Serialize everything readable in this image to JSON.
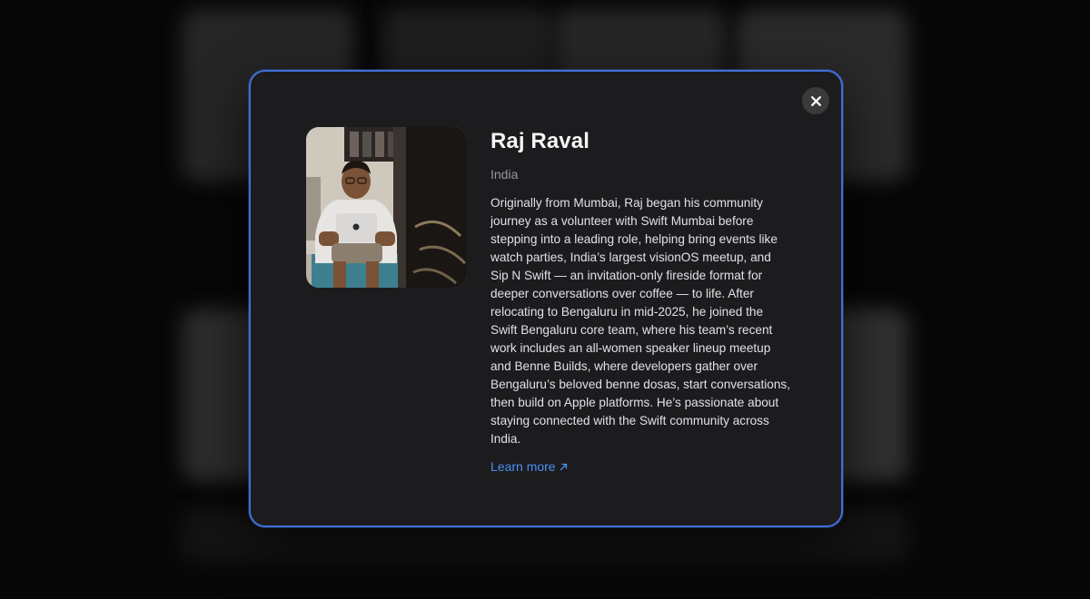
{
  "profile": {
    "name": "Raj Raval",
    "country": "India",
    "bio": "Originally from Mumbai, Raj began his community journey as a volunteer with Swift Mumbai before stepping into a leading role, helping bring events like watch parties, India’s largest visionOS meetup, and Sip N Swift — an invitation-only fireside format for deeper conversations over coffee — to life. After relocating to Bengaluru in mid-2025, he joined the Swift Bengaluru core team, where his team’s recent work includes an all-women speaker lineup meetup and Benne Builds, where developers gather over Bengaluru’s beloved benne dosas, start conversations, then build on Apple platforms. He’s passionate about staying connected with the Swift community across India.",
    "learn_more_label": "Learn more",
    "learn_more_icon": "arrow-up-right-icon"
  },
  "modal": {
    "close_icon": "close-icon"
  },
  "colors": {
    "accent": "#4c8ff6",
    "modal_border": "#3f6fd6",
    "modal_background": "#1c1c1e",
    "page_background": "#060606"
  }
}
